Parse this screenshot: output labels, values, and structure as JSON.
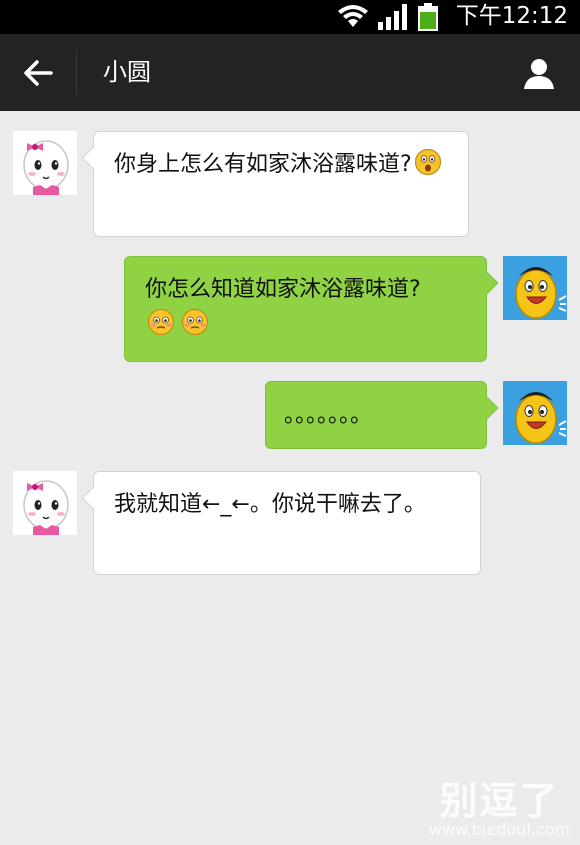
{
  "status_bar": {
    "time": "下午12:12",
    "icons": [
      "wifi-icon",
      "signal-icon",
      "battery-icon"
    ],
    "battery_color": "#4caf1a"
  },
  "header": {
    "title": "小圆",
    "back_icon": "back-arrow-icon",
    "profile_icon": "person-icon"
  },
  "messages": [
    {
      "direction": "incoming",
      "avatar": "girl-avatar",
      "text": "你身上怎么有如家沐浴露味道?",
      "emoji": [
        "shocked-emoji"
      ]
    },
    {
      "direction": "outgoing",
      "avatar": "bean-avatar",
      "text": "你怎么知道如家沐浴露味道?",
      "emoji": [
        "blush-emoji",
        "blush-emoji"
      ]
    },
    {
      "direction": "outgoing",
      "avatar": "bean-avatar",
      "text": "。。。。。。。",
      "emoji": []
    },
    {
      "direction": "incoming",
      "avatar": "girl-avatar",
      "text": "我就知道←_←。你说干嘛去了。",
      "emoji": []
    }
  ],
  "watermark": {
    "chinese": "别逗了",
    "url": "www.biedoul.com"
  },
  "colors": {
    "chat_background": "#ebebeb",
    "title_bar": "#232323",
    "outgoing_bubble": "#8fd344",
    "incoming_bubble": "#ffffff"
  }
}
